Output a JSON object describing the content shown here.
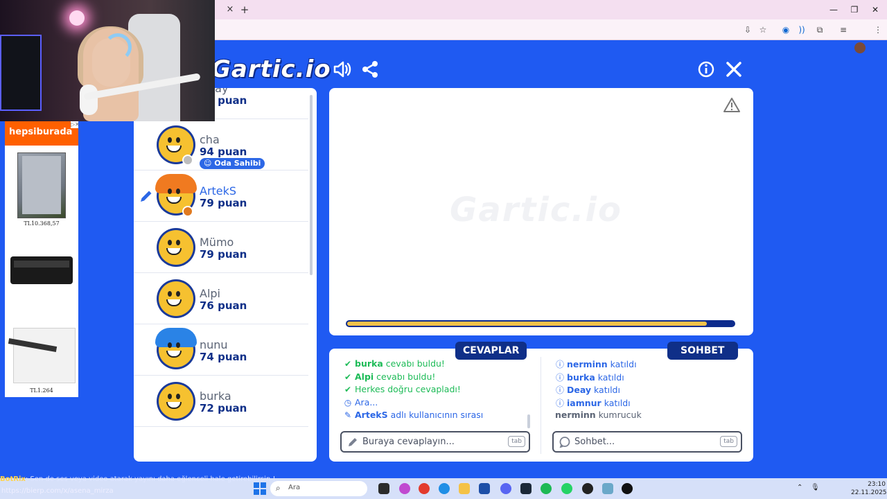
{
  "browser": {
    "tab_close": "×",
    "tab_new": "+",
    "minimize": "—",
    "restore": "❐",
    "close": "✕"
  },
  "game": {
    "logo": "Gartic.io",
    "canvas_watermark": "Gartic.io",
    "timer_fraction": 0.93,
    "colors": {
      "bg": "#1f5af2",
      "navy": "#0f2f88",
      "accent": "#2c67e6",
      "timer": "#f3c24a",
      "green": "#1dbb57"
    }
  },
  "players": [
    {
      "name": "Deay",
      "points": "95 puan",
      "status": "#f3c330",
      "hair": ""
    },
    {
      "name": "cha",
      "points": "94 puan",
      "status": "#bdbdbd",
      "badge": "Oda Sahibi",
      "hair": ""
    },
    {
      "name": "ArtekS",
      "points": "79 puan",
      "status": "#e07a20",
      "drawing": true,
      "hair": "#f07a20"
    },
    {
      "name": "Mümo",
      "points": "79 puan",
      "status": "",
      "hair": ""
    },
    {
      "name": "Alpi",
      "points": "76 puan",
      "status": "",
      "hair": ""
    },
    {
      "name": "nunu",
      "points": "74 puan",
      "status": "",
      "hair": "#2a83e6"
    },
    {
      "name": "burka",
      "points": "72 puan",
      "status": "",
      "hair": ""
    }
  ],
  "tabs": {
    "answers": "CEVAPLAR",
    "chat": "SOHBET"
  },
  "answers": [
    {
      "icon": "✔",
      "user": "burka",
      "text": " cevabı buldu!",
      "color": "green"
    },
    {
      "icon": "✔",
      "user": "Alpi",
      "text": " cevabı buldu!",
      "color": "green"
    },
    {
      "icon": "✔",
      "user": "",
      "text": "Herkes doğru cevapladı!",
      "color": "green"
    },
    {
      "icon": "◷",
      "user": "",
      "text": "Ara...",
      "color": "blue"
    },
    {
      "icon": "✎",
      "user": "ArtekS",
      "text": " adlı kullanıcının sırası",
      "color": "blue"
    }
  ],
  "chat": [
    {
      "icon": "ⓘ",
      "user": "nerminn",
      "text": " katıldı",
      "color": "blue"
    },
    {
      "icon": "ⓘ",
      "user": "burka",
      "text": " katıldı",
      "color": "blue"
    },
    {
      "icon": "ⓘ",
      "user": "Deay",
      "text": " katıldı",
      "color": "blue"
    },
    {
      "icon": "ⓘ",
      "user": "iamnur",
      "text": " katıldı",
      "color": "blue"
    },
    {
      "icon": "",
      "user": "nerminn",
      "text": " kumrucuk",
      "color": "gray"
    }
  ],
  "inputs": {
    "answer_placeholder": "Buraya cevaplayın...",
    "chat_placeholder": "Sohbet...",
    "tab_key": "tab"
  },
  "ad": {
    "brand": "hepsiburada",
    "close": "▷✕",
    "price1": "TL10.368,57",
    "price2": "TL1.264"
  },
  "stream": {
    "notice_user": "BotRix",
    "notice_text": ": Sen de ses veya video atarak yayını daha eğlenceli hale getirebilirsin !",
    "url": "https://bierp.com/x/asena_mirza"
  },
  "taskbar": {
    "search_placeholder": "Ara",
    "time": "23:10",
    "date": "22.11.2025"
  }
}
